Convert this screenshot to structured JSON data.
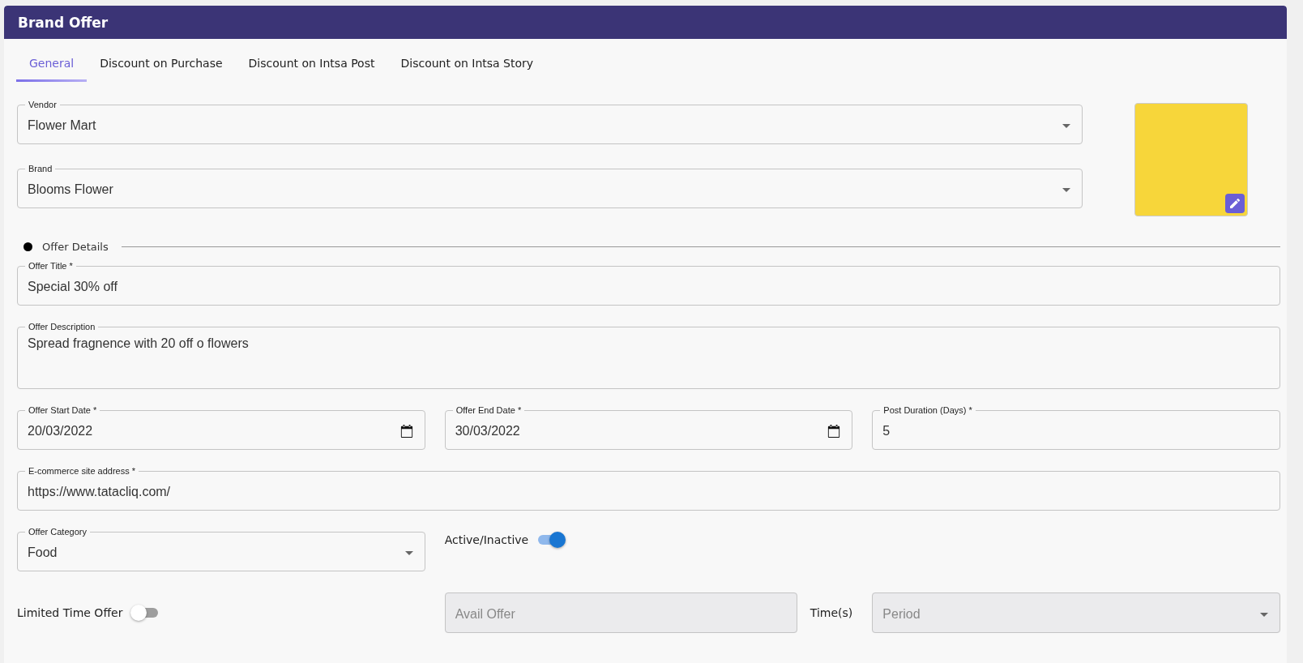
{
  "header": {
    "title": "Brand Offer"
  },
  "tabs": [
    {
      "label": "General",
      "selected": true
    },
    {
      "label": "Discount on Purchase",
      "selected": false
    },
    {
      "label": "Discount on Intsa Post",
      "selected": false
    },
    {
      "label": "Discount on Intsa Story",
      "selected": false
    }
  ],
  "vendor": {
    "label": "Vendor",
    "value": "Flower Mart",
    "kind": "select"
  },
  "brand": {
    "label": "Brand",
    "value": "Blooms Flower",
    "kind": "select"
  },
  "section": {
    "title": "Offer Details"
  },
  "offer_title": {
    "label": "Offer Title *",
    "value": "Special 30% off"
  },
  "offer_description": {
    "label": "Offer Description",
    "value": "Spread fragnence with 20 off o flowers",
    "kind": "textarea"
  },
  "dates": [
    {
      "label": "Offer Start Date *",
      "value": "20/03/2022",
      "kind": "date"
    },
    {
      "label": "Offer End Date *",
      "value": "30/03/2022",
      "kind": "date"
    },
    {
      "label": "Post Duration (Days) *",
      "value": "5",
      "kind": "number"
    }
  ],
  "ecommerce": {
    "label": "E-commerce site address *",
    "value": "https://www.tatacliq.com/"
  },
  "offer_category": {
    "label": "Offer Category",
    "value": "Food",
    "kind": "select"
  },
  "active_toggle": {
    "label": "Active/Inactive",
    "on": true
  },
  "limited_toggle": {
    "label": "Limited Time Offer",
    "on": false
  },
  "avail_offer": {
    "placeholder": "Avail Offer",
    "disabled": true
  },
  "times_label": "Time(s)",
  "period": {
    "placeholder": "Period",
    "disabled": true,
    "kind": "select"
  }
}
